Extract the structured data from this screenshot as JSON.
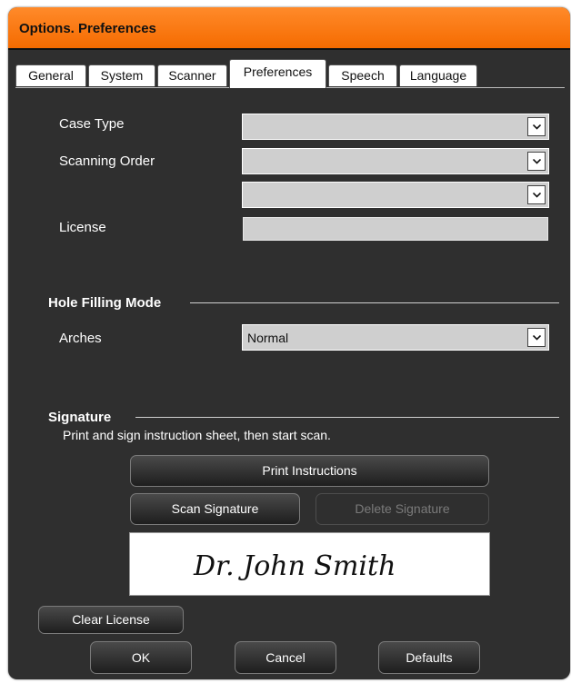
{
  "window": {
    "title": "Options. Preferences"
  },
  "tabs": [
    {
      "label": "General"
    },
    {
      "label": "System"
    },
    {
      "label": "Scanner"
    },
    {
      "label": "Preferences"
    },
    {
      "label": "Speech"
    },
    {
      "label": "Language"
    }
  ],
  "preferences": {
    "case_type_label": "Case Type",
    "case_type_value": "",
    "scanning_order_label": "Scanning Order",
    "scanning_order_value": "",
    "scanning_order_value2": "",
    "license_label": "License",
    "license_value": ""
  },
  "hole_filling": {
    "title": "Hole Filling Mode",
    "arches_label": "Arches",
    "arches_value": "Normal"
  },
  "signature": {
    "title": "Signature",
    "instructions": "Print and sign instruction sheet, then start scan.",
    "print_button": "Print Instructions",
    "scan_button": "Scan Signature",
    "delete_button": "Delete Signature",
    "signature_text": "Dr. John Smith"
  },
  "clear_license_button": "Clear License",
  "footer": {
    "ok": "OK",
    "cancel": "Cancel",
    "defaults": "Defaults"
  },
  "colors": {
    "titlebar": "#f56b00",
    "window_bg": "#2f2f2f"
  }
}
